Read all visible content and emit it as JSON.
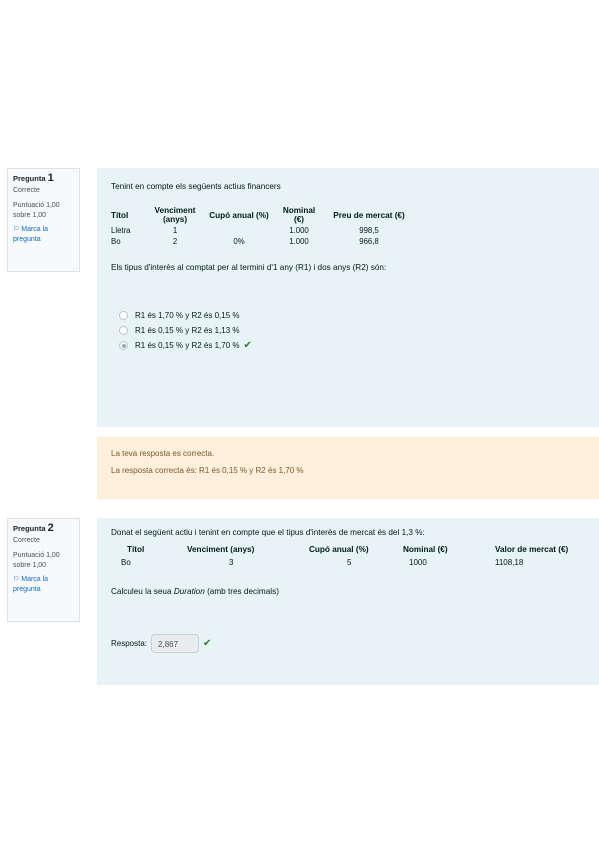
{
  "q1": {
    "info": {
      "label": "Pregunta",
      "number": "1",
      "state": "Correcte",
      "grade": "Puntuació 1,00 sobre 1,00",
      "flag": "Marca la pregunta"
    },
    "intro": "Tenint en compte els següents actius financers",
    "table": {
      "headers": [
        "Títol",
        "Venciment (anys)",
        "Cupó anual (%)",
        "Nominal (€)",
        "Preu de mercat (€)"
      ],
      "rows": [
        [
          "Lletra",
          "1",
          "",
          "1.000",
          "998,5"
        ],
        [
          "Bo",
          "2",
          "0%",
          "1.000",
          "966,8"
        ]
      ]
    },
    "question": "Els tipus d'interès al comptat per al termini d'1 any (R1) i dos anys (R2) són:",
    "options": [
      {
        "text": "R1 és 1,70 % y R2 és 0,15 %",
        "selected": false
      },
      {
        "text": "R1 és 0,15 % y R2 és 1,13 %",
        "selected": false
      },
      {
        "text": "R1 és 0,15 % y R2 és 1,70 %",
        "selected": true
      }
    ],
    "feedback": {
      "general": "La teva resposta es correcta.",
      "right_answer": "La resposta correcta és: R1 és 0,15 % y R2 és 1,70 %"
    }
  },
  "q2": {
    "info": {
      "label": "Pregunta",
      "number": "2",
      "state": "Correcte",
      "grade": "Puntuació 1,00 sobre 1,00",
      "flag": "Marca la pregunta"
    },
    "intro": "Donat el següent actiu i tenint en compte que el tipus d'interès de mercat és del 1,3 %:",
    "table": {
      "headers": [
        "Títol",
        "Venciment (anys)",
        "Cupó anual (%)",
        "Nominal (€)",
        "Valor de mercat (€)"
      ],
      "rows": [
        [
          "Bo",
          "3",
          "5",
          "1000",
          "1108,18"
        ]
      ]
    },
    "question_pre": "Calculeu la seua",
    "question_em": "Duration",
    "question_post": "(amb tres decimals)",
    "answer_label": "Resposta:",
    "answer_value": "2,867"
  },
  "colors": {
    "question_bg": "#e7f3f5",
    "feedback_bg": "#fcefdc",
    "correct": "#357a32",
    "info_bg": "#f8f9fa"
  },
  "icons": [
    "flag-icon",
    "check-icon",
    "radio-icon"
  ]
}
